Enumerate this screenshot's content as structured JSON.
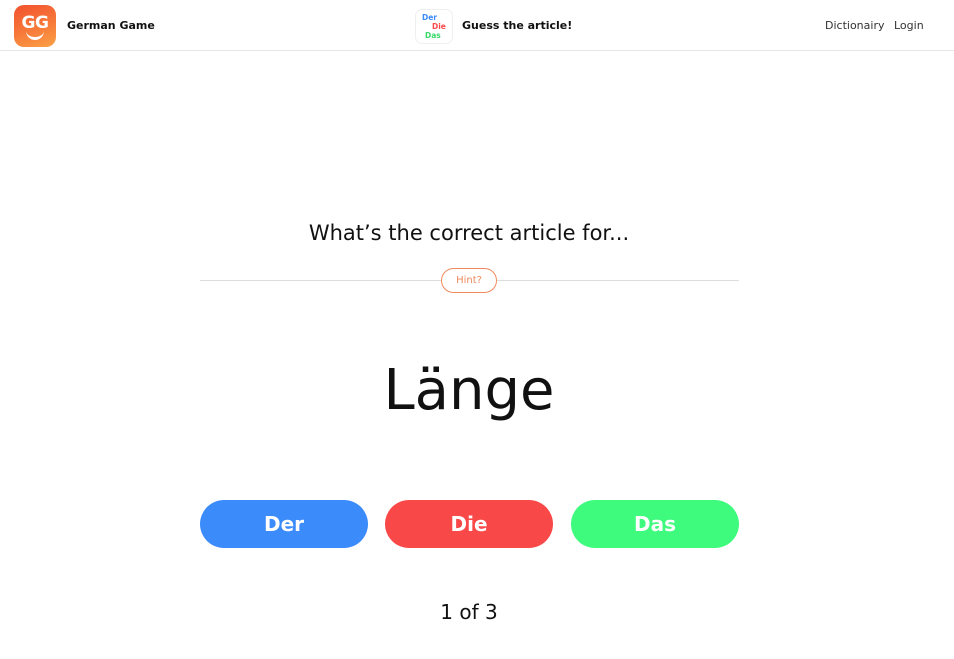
{
  "header": {
    "logo_text": "GG",
    "brand_name": "German Game",
    "game_icon": {
      "line1": "Der",
      "line2": "Die",
      "line3": "Das"
    },
    "game_title": "Guess the article!",
    "nav": {
      "dictionary": "Dictionairy",
      "login": "Login"
    }
  },
  "main": {
    "prompt": "What’s the correct article for...",
    "hint_label": "Hint?",
    "word": "Länge",
    "answers": {
      "der": "Der",
      "die": "Die",
      "das": "Das"
    },
    "progress": "1 of 3"
  },
  "colors": {
    "der": "#3b8bfa",
    "die": "#f94848",
    "das": "#3efb7e",
    "hint": "#f08a5d",
    "logo_gradient_start": "#f2512e",
    "logo_gradient_end": "#fba146"
  }
}
